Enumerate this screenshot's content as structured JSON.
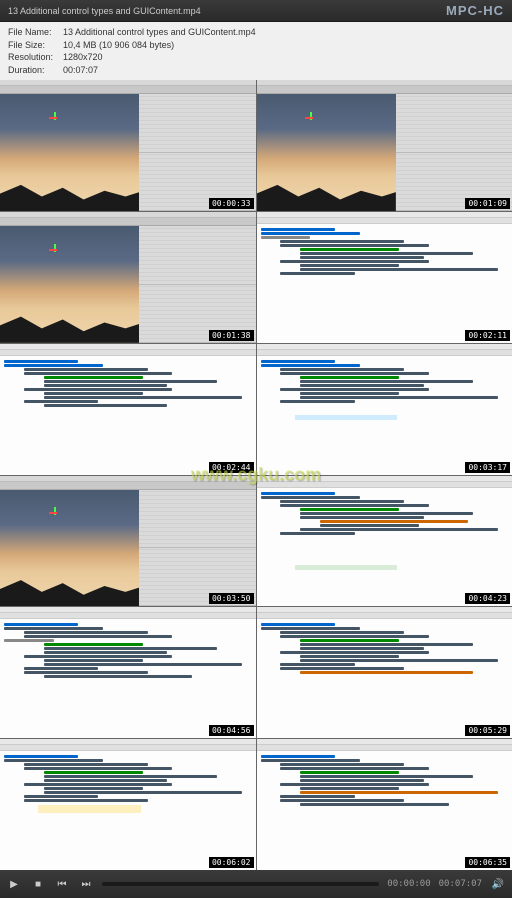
{
  "titlebar": {
    "title": "13 Additional control types and GUIContent.mp4",
    "logo": "MPC-HC"
  },
  "info": {
    "filename_label": "File Name:",
    "filename": "13 Additional control types and GUIContent.mp4",
    "filesize_label": "File Size:",
    "filesize": "10,4 MB (10 906 084 bytes)",
    "resolution_label": "Resolution:",
    "resolution": "1280x720",
    "duration_label": "Duration:",
    "duration": "00:07:07"
  },
  "watermark": "www.cgku.com",
  "timestamps": [
    "00:00:33",
    "00:01:09",
    "00:01:38",
    "00:02:11",
    "00:02:44",
    "00:03:17",
    "00:03:50",
    "00:04:23",
    "00:04:56",
    "00:05:29",
    "00:06:02",
    "00:06:35"
  ],
  "controls": {
    "play_icon": "▶",
    "stop_icon": "■",
    "prev_icon": "⏮",
    "next_icon": "⏭",
    "vol_icon": "🔊",
    "current_time": "00:00:00",
    "total_time": "00:07:07"
  }
}
